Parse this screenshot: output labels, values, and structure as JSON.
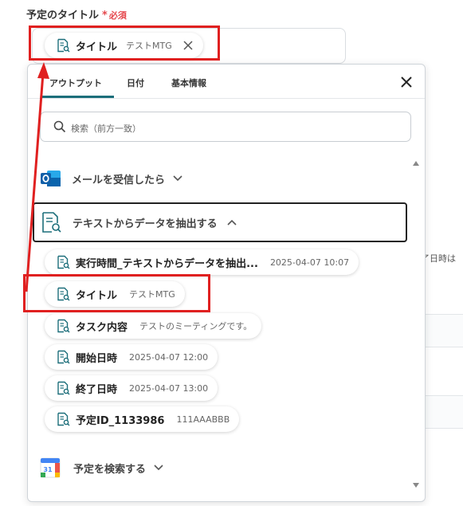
{
  "field": {
    "label": "予定のタイトル",
    "required_mark": "*",
    "required_text": "必須"
  },
  "selected_pill": {
    "title": "タイトル",
    "value": "テストMTG"
  },
  "tabs": [
    {
      "label": "アウトプット",
      "active": true
    },
    {
      "label": "日付",
      "active": false
    },
    {
      "label": "基本情報",
      "active": false
    }
  ],
  "search": {
    "placeholder": "検索（前方一致）"
  },
  "sections": {
    "mail": {
      "label": "メールを受信したら"
    },
    "extract": {
      "label": "テキストからデータを抽出する"
    },
    "calendar": {
      "label": "予定を検索する",
      "icon_text": "31"
    }
  },
  "outputs": [
    {
      "title": "実行時間_テキストからデータを抽出...",
      "value": "2025-04-07 10:07"
    },
    {
      "title": "タイトル",
      "value": "テストMTG"
    },
    {
      "title": "タスク内容",
      "value": "テストのミーティングです。"
    },
    {
      "title": "開始日時",
      "value": "2025-04-07 12:00"
    },
    {
      "title": "終了日時",
      "value": "2025-04-07 13:00"
    },
    {
      "title": "予定ID_1133986",
      "value": "111AAABBB"
    }
  ],
  "background": {
    "right_text": "了日時は"
  },
  "colors": {
    "accent": "#1c6e7a",
    "required": "#e5484d",
    "highlight": "#e02020"
  }
}
